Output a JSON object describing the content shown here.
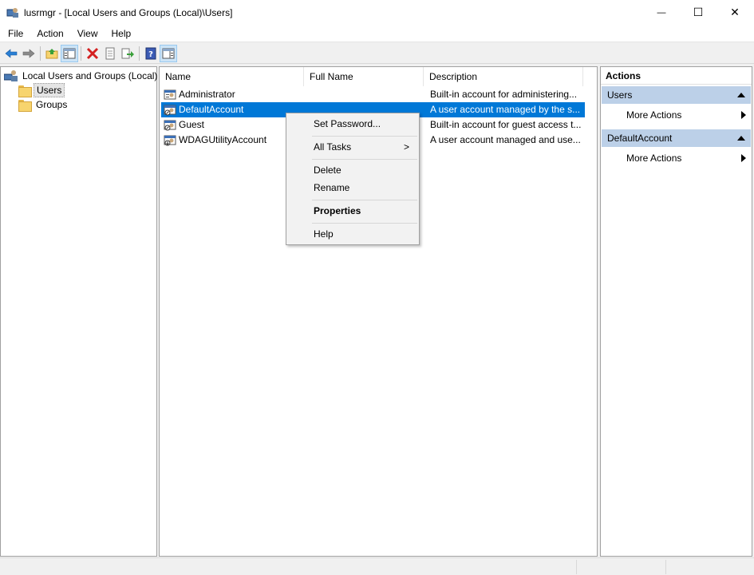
{
  "window": {
    "title": "lusrmgr - [Local Users and Groups (Local)\\Users]",
    "minimize_glyph": "—",
    "maximize_glyph": "☐",
    "close_glyph": "✕"
  },
  "menu": [
    "File",
    "Action",
    "View",
    "Help"
  ],
  "toolbar": {
    "icons": [
      "back-icon",
      "forward-icon",
      "up-folder-icon",
      "show-hide-tree-icon",
      "delete-icon",
      "properties-icon",
      "export-icon",
      "help-icon",
      "show-hide-action-pane-icon"
    ]
  },
  "tree": {
    "root": "Local Users and Groups (Local)",
    "children": [
      "Users",
      "Groups"
    ],
    "selected": "Users"
  },
  "list": {
    "columns": [
      "Name",
      "Full Name",
      "Description"
    ],
    "rows": [
      {
        "name": "Administrator",
        "full_name": "",
        "description": "Built-in account for administering..."
      },
      {
        "name": "DefaultAccount",
        "full_name": "",
        "description": "A user account managed by the s..."
      },
      {
        "name": "Guest",
        "full_name": "",
        "description": "Built-in account for guest access t..."
      },
      {
        "name": "WDAGUtilityAccount",
        "full_name": "",
        "description": "A user account managed and use..."
      }
    ],
    "selected": "DefaultAccount",
    "selection_color": "#0078d7"
  },
  "context_menu": {
    "items": [
      {
        "label": "Set Password..."
      },
      {
        "label": "All Tasks",
        "arrow": ">"
      },
      {
        "label": "Delete"
      },
      {
        "label": "Rename"
      },
      {
        "label": "Properties"
      },
      {
        "label": "Help"
      }
    ]
  },
  "actions": {
    "header": "Actions",
    "sections": [
      {
        "title": "Users",
        "items": [
          "More Actions"
        ]
      },
      {
        "title": "DefaultAccount",
        "items": [
          "More Actions"
        ]
      }
    ],
    "section_color": "#bcd0e8"
  }
}
